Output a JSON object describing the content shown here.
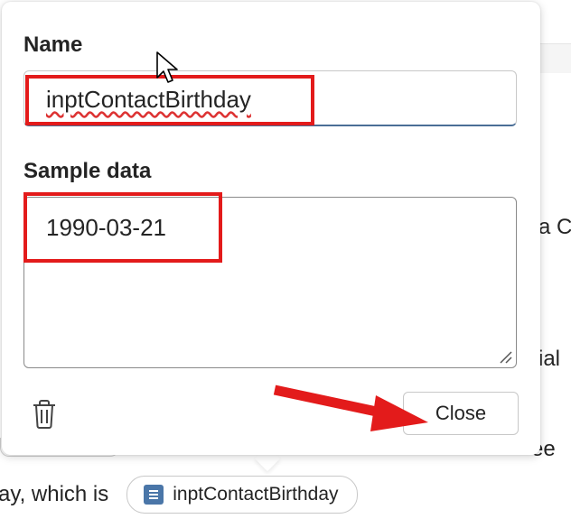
{
  "background": {
    "prefix_text": "ay, which is",
    "pill_label": "inptContactBirthday",
    "tail_texts": [
      "a C",
      "ial",
      "ee"
    ]
  },
  "popup": {
    "name_label": "Name",
    "name_value": "inptContactBirthday",
    "sample_label": "Sample data",
    "sample_value": "1990-03-21",
    "close_label": "Close"
  },
  "annotations": {
    "highlight_color": "#e31b1b",
    "arrow_color": "#e31b1b"
  },
  "icons": [
    "trash-icon",
    "resize-handle-icon",
    "variable-icon",
    "mouse-pointer-icon"
  ]
}
